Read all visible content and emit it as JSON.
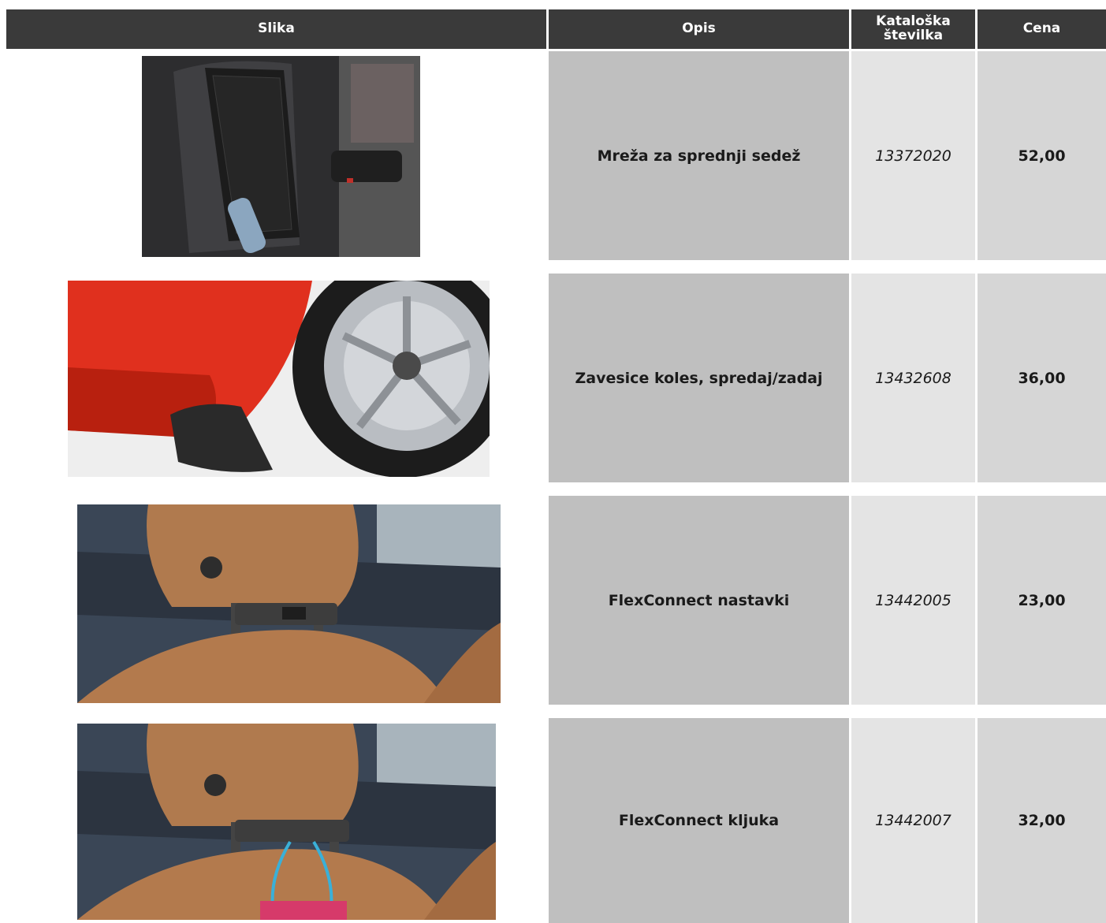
{
  "header": {
    "col_image": "Slika",
    "col_desc": "Opis",
    "col_catalog": "Kataloška številka",
    "col_price": "Cena"
  },
  "rows": [
    {
      "image": "front-seat-net-photo",
      "description": "Mreža za sprednji sedež",
      "catalog": "13372020",
      "price": "52,00"
    },
    {
      "image": "mud-flaps-photo",
      "description": "Zavesice koles, spredaj/zadaj",
      "catalog": "13432608",
      "price": "36,00"
    },
    {
      "image": "flexconnect-adapter-photo",
      "description": "FlexConnect nastavki",
      "catalog": "13442005",
      "price": "23,00"
    },
    {
      "image": "flexconnect-hook-photo",
      "description": "FlexConnect kljuka",
      "catalog": "13442007",
      "price": "32,00"
    }
  ]
}
